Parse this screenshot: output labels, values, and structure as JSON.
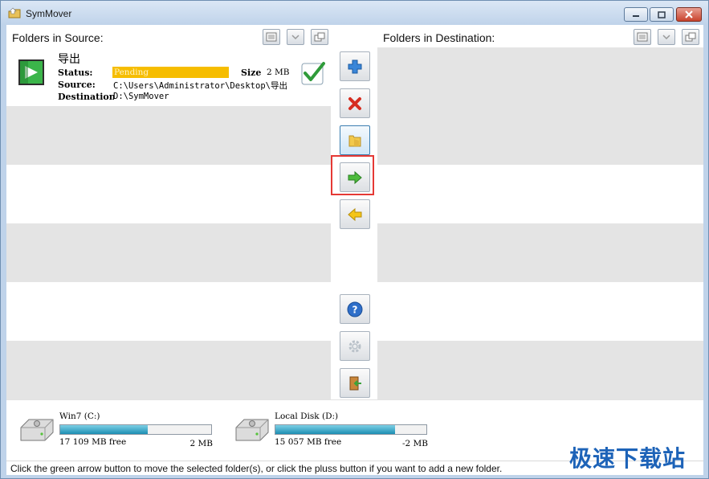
{
  "window": {
    "title": "SymMover",
    "controls": [
      "minimize",
      "maximize",
      "close"
    ]
  },
  "source_pane": {
    "title": "Folders in Source:",
    "items": [
      {
        "name": "导出",
        "status_label": "Status:",
        "status_value": "Pending",
        "size_label": "Size",
        "size_value": "2 MB",
        "source_label": "Source:",
        "source_value": "C:\\Users\\Administrator\\Desktop\\导出",
        "destination_label": "Destination:",
        "destination_value": "D:\\SymMover"
      }
    ]
  },
  "dest_pane": {
    "title": "Folders in Destination:"
  },
  "toolbar": {
    "buttons": [
      {
        "name": "add-folder",
        "icon": "plus-icon"
      },
      {
        "name": "remove-folder",
        "icon": "red-x-icon"
      },
      {
        "name": "open-folder",
        "icon": "folder-icon"
      },
      {
        "name": "move-right",
        "icon": "green-arrow-right-icon"
      },
      {
        "name": "move-left",
        "icon": "yellow-arrow-left-icon"
      },
      {
        "name": "help",
        "icon": "question-icon"
      },
      {
        "name": "settings",
        "icon": "gear-icon"
      },
      {
        "name": "exit",
        "icon": "exit-door-icon"
      }
    ]
  },
  "disks": [
    {
      "name": "Win7 (C:)",
      "free": "17 109 MB free",
      "total": "2 MB",
      "used_fraction": 0.58
    },
    {
      "name": "Local Disk (D:)",
      "free": "15 057 MB free",
      "total": "-2 MB",
      "used_fraction": 0.79
    }
  ],
  "status": {
    "text": "Click the green arrow button to move the selected folder(s), or click the pluss button if you want to add a new folder."
  },
  "watermark": "极速下载站",
  "colors": {
    "status_pending": "#f6bd00",
    "disk_bar": "#1c8eb3",
    "highlight": "#e53935",
    "row_alt": "#e4e4e4"
  }
}
